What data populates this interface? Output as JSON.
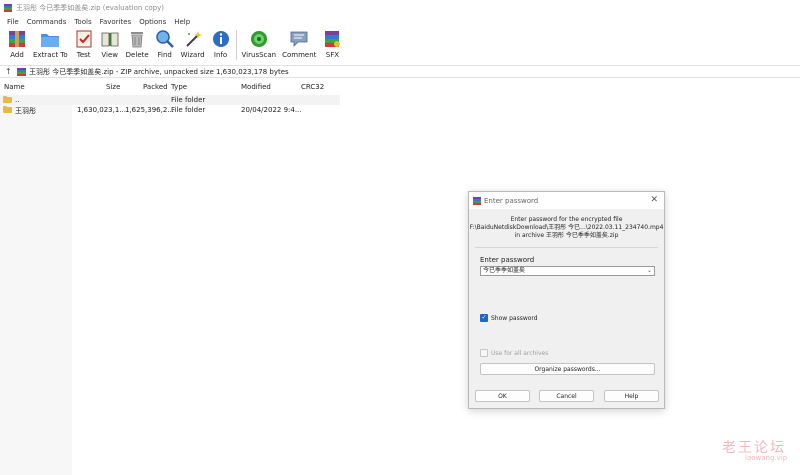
{
  "window": {
    "title": "王羽彤 今已季季如盖矣.zip (evaluation copy)"
  },
  "menu": [
    "File",
    "Commands",
    "Tools",
    "Favorites",
    "Options",
    "Help"
  ],
  "toolbar": {
    "buttons": [
      {
        "label": "Add",
        "icon": "add-archive-icon"
      },
      {
        "label": "Extract To",
        "icon": "extract-folder-icon"
      },
      {
        "label": "Test",
        "icon": "test-icon"
      },
      {
        "label": "View",
        "icon": "view-book-icon"
      },
      {
        "label": "Delete",
        "icon": "trash-icon"
      },
      {
        "label": "Find",
        "icon": "magnifier-icon"
      },
      {
        "label": "Wizard",
        "icon": "wand-icon"
      },
      {
        "label": "Info",
        "icon": "info-icon"
      },
      {
        "label": "VirusScan",
        "icon": "virus-icon"
      },
      {
        "label": "Comment",
        "icon": "comment-icon"
      },
      {
        "label": "SFX",
        "icon": "sfx-icon"
      }
    ]
  },
  "address": {
    "text": "王羽彤 今已季季如盖矣.zip - ZIP archive, unpacked size 1,630,023,178 bytes"
  },
  "filelist": {
    "columns": [
      "Name",
      "Size",
      "Packed",
      "Type",
      "Modified",
      "CRC32"
    ],
    "rows": [
      {
        "name": "..",
        "size": "",
        "packed": "",
        "type": "File folder",
        "modified": ""
      },
      {
        "name": "王羽彤",
        "size": "1,630,023,1...",
        "packed": "1,625,396,2...",
        "type": "File folder",
        "modified": "20/04/2022 9:4..."
      }
    ]
  },
  "dialog": {
    "title": "Enter password",
    "info_line1": "Enter password for the encrypted file",
    "info_line2": "F:\\BaiduNetdiskDownload\\王羽彤 今已...\\2022.03.11_234740.mp4",
    "info_line3": "in archive 王羽彤 今已季季如盖矣.zip",
    "password_label": "Enter password",
    "password_value": "今已季季如盖矣",
    "show_password_label": "Show password",
    "show_password_checked": true,
    "use_all_label": "Use for all archives",
    "organize_label": "Organize passwords...",
    "ok_label": "OK",
    "cancel_label": "Cancel",
    "help_label": "Help"
  },
  "watermark": {
    "line1": "老王论坛",
    "line2": "laowang.vip"
  },
  "colors": {
    "accent": "#1f64c8",
    "folder": "#e8b94a",
    "watermark": "#f2b8c0"
  }
}
